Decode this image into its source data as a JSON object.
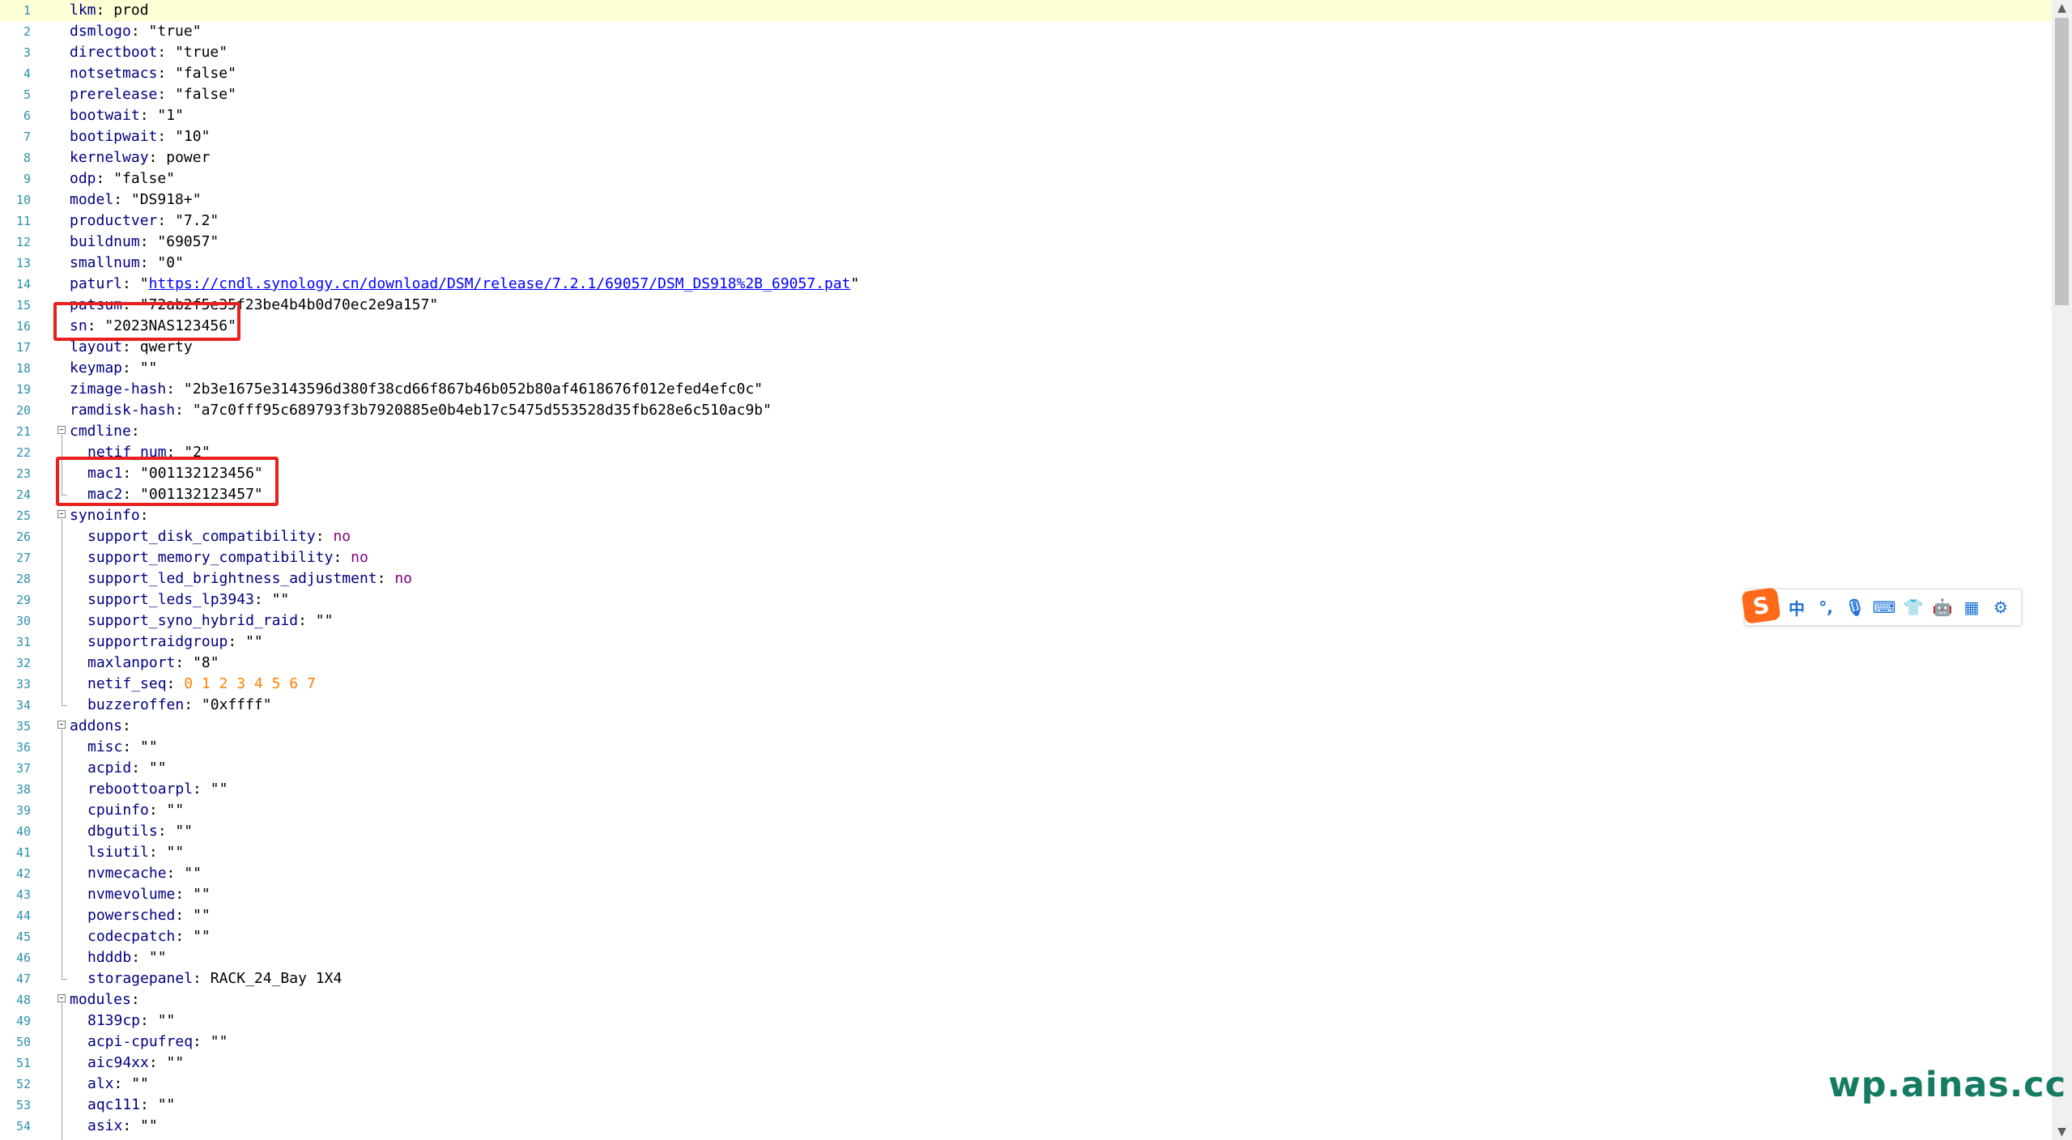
{
  "editor": {
    "lines": [
      {
        "n": "1",
        "indent": 0,
        "fold": "",
        "tokens": [
          [
            "k",
            "lkm"
          ],
          [
            "p",
            ": "
          ],
          [
            "s",
            "prod"
          ]
        ]
      },
      {
        "n": "2",
        "indent": 0,
        "fold": "",
        "tokens": [
          [
            "k",
            "dsmlogo"
          ],
          [
            "p",
            ": "
          ],
          [
            "s",
            "\"true\""
          ]
        ]
      },
      {
        "n": "3",
        "indent": 0,
        "fold": "",
        "tokens": [
          [
            "k",
            "directboot"
          ],
          [
            "p",
            ": "
          ],
          [
            "s",
            "\"true\""
          ]
        ]
      },
      {
        "n": "4",
        "indent": 0,
        "fold": "",
        "tokens": [
          [
            "k",
            "notsetmacs"
          ],
          [
            "p",
            ": "
          ],
          [
            "s",
            "\"false\""
          ]
        ]
      },
      {
        "n": "5",
        "indent": 0,
        "fold": "",
        "tokens": [
          [
            "k",
            "prerelease"
          ],
          [
            "p",
            ": "
          ],
          [
            "s",
            "\"false\""
          ]
        ]
      },
      {
        "n": "6",
        "indent": 0,
        "fold": "",
        "tokens": [
          [
            "k",
            "bootwait"
          ],
          [
            "p",
            ": "
          ],
          [
            "s",
            "\"1\""
          ]
        ]
      },
      {
        "n": "7",
        "indent": 0,
        "fold": "",
        "tokens": [
          [
            "k",
            "bootipwait"
          ],
          [
            "p",
            ": "
          ],
          [
            "s",
            "\"10\""
          ]
        ]
      },
      {
        "n": "8",
        "indent": 0,
        "fold": "",
        "tokens": [
          [
            "k",
            "kernelway"
          ],
          [
            "p",
            ": "
          ],
          [
            "s",
            "power"
          ]
        ]
      },
      {
        "n": "9",
        "indent": 0,
        "fold": "",
        "tokens": [
          [
            "k",
            "odp"
          ],
          [
            "p",
            ": "
          ],
          [
            "s",
            "\"false\""
          ]
        ]
      },
      {
        "n": "10",
        "indent": 0,
        "fold": "",
        "tokens": [
          [
            "k",
            "model"
          ],
          [
            "p",
            ": "
          ],
          [
            "s",
            "\"DS918+\""
          ]
        ]
      },
      {
        "n": "11",
        "indent": 0,
        "fold": "",
        "tokens": [
          [
            "k",
            "productver"
          ],
          [
            "p",
            ": "
          ],
          [
            "s",
            "\"7.2\""
          ]
        ]
      },
      {
        "n": "12",
        "indent": 0,
        "fold": "",
        "tokens": [
          [
            "k",
            "buildnum"
          ],
          [
            "p",
            ": "
          ],
          [
            "s",
            "\"69057\""
          ]
        ]
      },
      {
        "n": "13",
        "indent": 0,
        "fold": "",
        "tokens": [
          [
            "k",
            "smallnum"
          ],
          [
            "p",
            ": "
          ],
          [
            "s",
            "\"0\""
          ]
        ]
      },
      {
        "n": "14",
        "indent": 0,
        "fold": "",
        "tokens": [
          [
            "k",
            "paturl"
          ],
          [
            "p",
            ": "
          ],
          [
            "s",
            "\""
          ],
          [
            "link",
            "https://cndl.synology.cn/download/DSM/release/7.2.1/69057/DSM_DS918%2B_69057.pat"
          ],
          [
            "s",
            "\""
          ]
        ]
      },
      {
        "n": "15",
        "indent": 0,
        "fold": "",
        "tokens": [
          [
            "k",
            "patsum"
          ],
          [
            "p",
            ": "
          ],
          [
            "s",
            "\"72ab2f5e35f23be4b4b0d70ec2e9a157\""
          ]
        ]
      },
      {
        "n": "16",
        "indent": 0,
        "fold": "",
        "tokens": [
          [
            "k",
            "sn"
          ],
          [
            "p",
            ": "
          ],
          [
            "s",
            "\"2023NAS123456\""
          ]
        ]
      },
      {
        "n": "17",
        "indent": 0,
        "fold": "",
        "tokens": [
          [
            "k",
            "layout"
          ],
          [
            "p",
            ": "
          ],
          [
            "s",
            "qwerty"
          ]
        ]
      },
      {
        "n": "18",
        "indent": 0,
        "fold": "",
        "tokens": [
          [
            "k",
            "keymap"
          ],
          [
            "p",
            ": "
          ],
          [
            "s",
            "\"\""
          ]
        ]
      },
      {
        "n": "19",
        "indent": 0,
        "fold": "",
        "tokens": [
          [
            "k",
            "zimage-hash"
          ],
          [
            "p",
            ": "
          ],
          [
            "s",
            "\"2b3e1675e3143596d380f38cd66f867b46b052b80af4618676f012efed4efc0c\""
          ]
        ]
      },
      {
        "n": "20",
        "indent": 0,
        "fold": "",
        "tokens": [
          [
            "k",
            "ramdisk-hash"
          ],
          [
            "p",
            ": "
          ],
          [
            "s",
            "\"a7c0fff95c689793f3b7920885e0b4eb17c5475d553528d35fb628e6c510ac9b\""
          ]
        ]
      },
      {
        "n": "21",
        "indent": 0,
        "fold": "start",
        "tokens": [
          [
            "k",
            "cmdline"
          ],
          [
            "p",
            ":"
          ]
        ]
      },
      {
        "n": "22",
        "indent": 1,
        "fold": "",
        "tokens": [
          [
            "k",
            "netif_num"
          ],
          [
            "p",
            ": "
          ],
          [
            "s",
            "\"2\""
          ]
        ]
      },
      {
        "n": "23",
        "indent": 1,
        "fold": "",
        "tokens": [
          [
            "k",
            "mac1"
          ],
          [
            "p",
            ": "
          ],
          [
            "s",
            "\"001132123456\""
          ]
        ]
      },
      {
        "n": "24",
        "indent": 1,
        "fold": "end",
        "tokens": [
          [
            "k",
            "mac2"
          ],
          [
            "p",
            ": "
          ],
          [
            "s",
            "\"001132123457\""
          ]
        ]
      },
      {
        "n": "25",
        "indent": 0,
        "fold": "start",
        "tokens": [
          [
            "k",
            "synoinfo"
          ],
          [
            "p",
            ":"
          ]
        ]
      },
      {
        "n": "26",
        "indent": 1,
        "fold": "",
        "tokens": [
          [
            "k",
            "support_disk_compatibility"
          ],
          [
            "p",
            ": "
          ],
          [
            "kw",
            "no"
          ]
        ]
      },
      {
        "n": "27",
        "indent": 1,
        "fold": "",
        "tokens": [
          [
            "k",
            "support_memory_compatibility"
          ],
          [
            "p",
            ": "
          ],
          [
            "kw",
            "no"
          ]
        ]
      },
      {
        "n": "28",
        "indent": 1,
        "fold": "",
        "tokens": [
          [
            "k",
            "support_led_brightness_adjustment"
          ],
          [
            "p",
            ": "
          ],
          [
            "kw",
            "no"
          ]
        ]
      },
      {
        "n": "29",
        "indent": 1,
        "fold": "",
        "tokens": [
          [
            "k",
            "support_leds_lp3943"
          ],
          [
            "p",
            ": "
          ],
          [
            "s",
            "\"\""
          ]
        ]
      },
      {
        "n": "30",
        "indent": 1,
        "fold": "",
        "tokens": [
          [
            "k",
            "support_syno_hybrid_raid"
          ],
          [
            "p",
            ": "
          ],
          [
            "s",
            "\"\""
          ]
        ]
      },
      {
        "n": "31",
        "indent": 1,
        "fold": "",
        "tokens": [
          [
            "k",
            "supportraidgroup"
          ],
          [
            "p",
            ": "
          ],
          [
            "s",
            "\"\""
          ]
        ]
      },
      {
        "n": "32",
        "indent": 1,
        "fold": "",
        "tokens": [
          [
            "k",
            "maxlanport"
          ],
          [
            "p",
            ": "
          ],
          [
            "s",
            "\"8\""
          ]
        ]
      },
      {
        "n": "33",
        "indent": 1,
        "fold": "",
        "tokens": [
          [
            "k",
            "netif_seq"
          ],
          [
            "p",
            ": "
          ],
          [
            "num",
            "0 1 2 3 4 5 6 7"
          ]
        ]
      },
      {
        "n": "34",
        "indent": 1,
        "fold": "end",
        "tokens": [
          [
            "k",
            "buzzeroffen"
          ],
          [
            "p",
            ": "
          ],
          [
            "s",
            "\"0xffff\""
          ]
        ]
      },
      {
        "n": "35",
        "indent": 0,
        "fold": "start",
        "tokens": [
          [
            "k",
            "addons"
          ],
          [
            "p",
            ":"
          ]
        ]
      },
      {
        "n": "36",
        "indent": 1,
        "fold": "",
        "tokens": [
          [
            "k",
            "misc"
          ],
          [
            "p",
            ": "
          ],
          [
            "s",
            "\"\""
          ]
        ]
      },
      {
        "n": "37",
        "indent": 1,
        "fold": "",
        "tokens": [
          [
            "k",
            "acpid"
          ],
          [
            "p",
            ": "
          ],
          [
            "s",
            "\"\""
          ]
        ]
      },
      {
        "n": "38",
        "indent": 1,
        "fold": "",
        "tokens": [
          [
            "k",
            "reboottoarpl"
          ],
          [
            "p",
            ": "
          ],
          [
            "s",
            "\"\""
          ]
        ]
      },
      {
        "n": "39",
        "indent": 1,
        "fold": "",
        "tokens": [
          [
            "k",
            "cpuinfo"
          ],
          [
            "p",
            ": "
          ],
          [
            "s",
            "\"\""
          ]
        ]
      },
      {
        "n": "40",
        "indent": 1,
        "fold": "",
        "tokens": [
          [
            "k",
            "dbgutils"
          ],
          [
            "p",
            ": "
          ],
          [
            "s",
            "\"\""
          ]
        ]
      },
      {
        "n": "41",
        "indent": 1,
        "fold": "",
        "tokens": [
          [
            "k",
            "lsiutil"
          ],
          [
            "p",
            ": "
          ],
          [
            "s",
            "\"\""
          ]
        ]
      },
      {
        "n": "42",
        "indent": 1,
        "fold": "",
        "tokens": [
          [
            "k",
            "nvmecache"
          ],
          [
            "p",
            ": "
          ],
          [
            "s",
            "\"\""
          ]
        ]
      },
      {
        "n": "43",
        "indent": 1,
        "fold": "",
        "tokens": [
          [
            "k",
            "nvmevolume"
          ],
          [
            "p",
            ": "
          ],
          [
            "s",
            "\"\""
          ]
        ]
      },
      {
        "n": "44",
        "indent": 1,
        "fold": "",
        "tokens": [
          [
            "k",
            "powersched"
          ],
          [
            "p",
            ": "
          ],
          [
            "s",
            "\"\""
          ]
        ]
      },
      {
        "n": "45",
        "indent": 1,
        "fold": "",
        "tokens": [
          [
            "k",
            "codecpatch"
          ],
          [
            "p",
            ": "
          ],
          [
            "s",
            "\"\""
          ]
        ]
      },
      {
        "n": "46",
        "indent": 1,
        "fold": "",
        "tokens": [
          [
            "k",
            "hdddb"
          ],
          [
            "p",
            ": "
          ],
          [
            "s",
            "\"\""
          ]
        ]
      },
      {
        "n": "47",
        "indent": 1,
        "fold": "end",
        "tokens": [
          [
            "k",
            "storagepanel"
          ],
          [
            "p",
            ": "
          ],
          [
            "s",
            "RACK_24_Bay 1X4"
          ]
        ]
      },
      {
        "n": "48",
        "indent": 0,
        "fold": "start",
        "tokens": [
          [
            "k",
            "modules"
          ],
          [
            "p",
            ":"
          ]
        ]
      },
      {
        "n": "49",
        "indent": 1,
        "fold": "",
        "tokens": [
          [
            "k",
            "8139cp"
          ],
          [
            "p",
            ": "
          ],
          [
            "s",
            "\"\""
          ]
        ]
      },
      {
        "n": "50",
        "indent": 1,
        "fold": "",
        "tokens": [
          [
            "k",
            "acpi-cpufreq"
          ],
          [
            "p",
            ": "
          ],
          [
            "s",
            "\"\""
          ]
        ]
      },
      {
        "n": "51",
        "indent": 1,
        "fold": "",
        "tokens": [
          [
            "k",
            "aic94xx"
          ],
          [
            "p",
            ": "
          ],
          [
            "s",
            "\"\""
          ]
        ]
      },
      {
        "n": "52",
        "indent": 1,
        "fold": "",
        "tokens": [
          [
            "k",
            "alx"
          ],
          [
            "p",
            ": "
          ],
          [
            "s",
            "\"\""
          ]
        ]
      },
      {
        "n": "53",
        "indent": 1,
        "fold": "",
        "tokens": [
          [
            "k",
            "aqc111"
          ],
          [
            "p",
            ": "
          ],
          [
            "s",
            "\"\""
          ]
        ]
      },
      {
        "n": "54",
        "indent": 1,
        "fold": "",
        "tokens": [
          [
            "k",
            "asix"
          ],
          [
            "p",
            ": "
          ],
          [
            "s",
            "\"\""
          ]
        ]
      }
    ],
    "active_line": "1"
  },
  "ime_toolbar": {
    "logo": "S",
    "buttons": [
      {
        "icon": "chinese-mode-icon",
        "glyph": "中"
      },
      {
        "icon": "punctuation-icon",
        "glyph": "°,"
      },
      {
        "icon": "microphone-icon",
        "glyph": "🎙"
      },
      {
        "icon": "keyboard-icon",
        "glyph": "⌨"
      },
      {
        "icon": "skin-shirt-icon",
        "glyph": "👕"
      },
      {
        "icon": "robot-assistant-icon",
        "glyph": "🤖"
      },
      {
        "icon": "toolbox-grid-icon",
        "glyph": "▦"
      },
      {
        "icon": "settings-gear-icon",
        "glyph": "⚙"
      }
    ]
  },
  "watermark": "wp.ainas.cc",
  "colors": {
    "key": "#000080",
    "keyword": "#800080",
    "number": "#ff8000",
    "link": "#0000ff",
    "line_number": "#2b91af",
    "active_line_bg": "#ffffd5",
    "highlight_box": "#e8201f",
    "watermark": "#157c63"
  }
}
